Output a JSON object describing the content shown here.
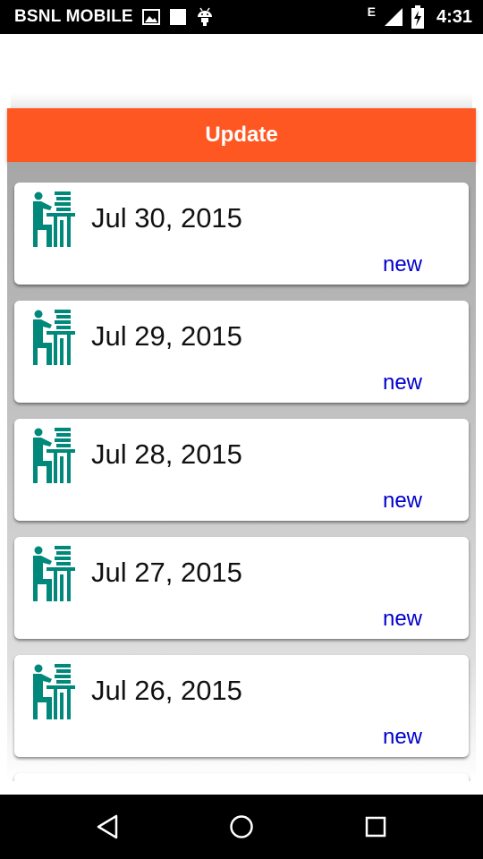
{
  "status_bar": {
    "carrier": "BSNL MOBILE",
    "network_type": "E",
    "time": "4:31",
    "icons": [
      "image-icon",
      "square-icon",
      "android-icon",
      "signal-icon",
      "battery-charging-icon"
    ]
  },
  "header": {
    "title": "Update",
    "color": "#ff5722"
  },
  "updates": [
    {
      "date": "Jul 30, 2015",
      "badge": "new"
    },
    {
      "date": "Jul 29, 2015",
      "badge": "new"
    },
    {
      "date": "Jul 28, 2015",
      "badge": "new"
    },
    {
      "date": "Jul 27, 2015",
      "badge": "new"
    },
    {
      "date": "Jul 26, 2015",
      "badge": "new"
    }
  ],
  "colors": {
    "icon": "#00897b",
    "badge": "#0000cc"
  },
  "nav_bar": {
    "icons": [
      "back-icon",
      "home-icon",
      "recents-icon"
    ]
  }
}
